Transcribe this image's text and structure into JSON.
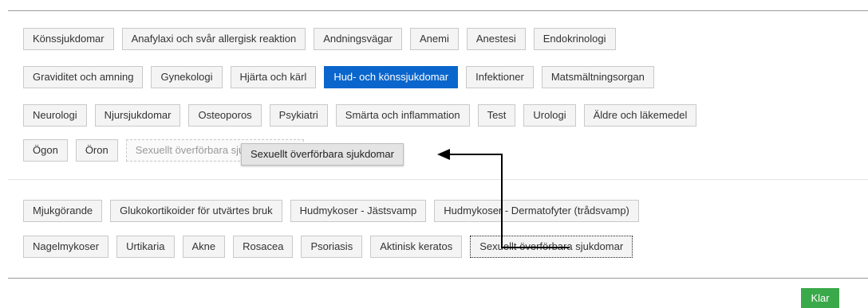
{
  "categories": {
    "row1": [
      "Könssjukdomar",
      "Anafylaxi och svår allergisk reaktion",
      "Andningsvägar",
      "Anemi",
      "Anestesi",
      "Endokrinologi"
    ],
    "row2": [
      "Graviditet och amning",
      "Gynekologi",
      "Hjärta och kärl",
      "Hud- och könssjukdomar",
      "Infektioner",
      "Matsmältningsorgan"
    ],
    "row3": [
      "Neurologi",
      "Njursjukdomar",
      "Osteoporos",
      "Psykiatri",
      "Smärta och inflammation",
      "Test",
      "Urologi",
      "Äldre och läkemedel"
    ],
    "row4": [
      "Ögon",
      "Öron"
    ],
    "active_label": "Hud- och könssjukdomar",
    "drop_placeholder": "Sexuellt överförbara sjukdomar"
  },
  "dragging_chip": "Sexuellt överförbara sjukdomar",
  "subcategories": {
    "row1": [
      "Mjukgörande",
      "Glukokortikoider för utvärtes bruk",
      "Hudmykoser - Jästsvamp",
      "Hudmykoser - Dermatofyter (trådsvamp)"
    ],
    "row2": [
      "Nagelmykoser",
      "Urtikaria",
      "Akne",
      "Rosacea",
      "Psoriasis",
      "Aktinisk keratos",
      "Sexuellt överförbara sjukdomar"
    ]
  },
  "footer": {
    "done_label": "Klar"
  },
  "colors": {
    "active": "#0a66cc",
    "done_button": "#3aa94a"
  },
  "icons": {
    "drag_arrow": "left-arrow"
  }
}
